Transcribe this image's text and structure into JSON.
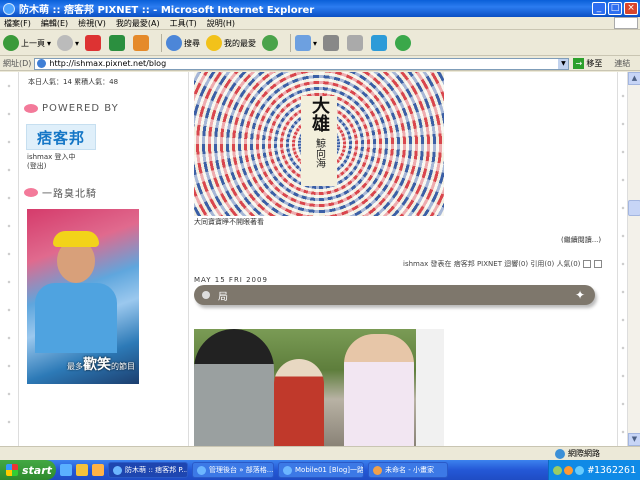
{
  "window": {
    "title": "防木萌 :: 痞客邦 PIXNET :: - Microsoft Internet Explorer"
  },
  "menu": [
    "檔案(F)",
    "編輯(E)",
    "檢視(V)",
    "我的最愛(A)",
    "工具(T)",
    "說明(H)"
  ],
  "toolbar": {
    "back_label": "上一頁",
    "search_label": "搜尋",
    "favorites_label": "我的最愛"
  },
  "address": {
    "label": "網址(D)",
    "url": "http://ishmax.pixnet.net/blog",
    "go_label": "移至",
    "links_label": "連結"
  },
  "sidebar": {
    "stats": "本日人氣：14 累積人氣：48",
    "powered_by": "POWERED BY",
    "logo_text": "痞客邦",
    "login_status": "ishmax 登入中",
    "logout": "(登出)",
    "section_title": "一路臭北騎",
    "photo_caption_prefix": "最多",
    "photo_caption_big": "歡笑",
    "photo_caption_suffix": "的節目"
  },
  "main": {
    "hero_title": "大雄",
    "hero_subtitle": "鯨向海",
    "hero_caption": "大同寶寶睜不開眼著看",
    "read_more": "(繼續閱讀...)",
    "post_meta": "ishmax 發表在 痞客邦 PIXNET 迴響(0) 引用(0) 人氣(0)",
    "post_date": "MAY 15 FRI 2009",
    "post_title": "局"
  },
  "statusbar": {
    "zone": "網際網路"
  },
  "taskbar": {
    "start_label": "start",
    "tasks": [
      "防木萌 :: 痞客邦 P...",
      "管理後台 » 部落格...",
      "Mobile01 [Blog]一路...",
      "未命名 - 小畫家"
    ],
    "watermark": "#1362261"
  }
}
